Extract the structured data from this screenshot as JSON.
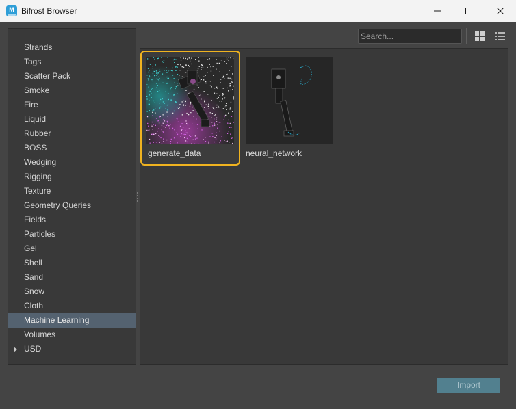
{
  "window": {
    "title": "Bifrost Browser",
    "app_icon_letter": "M",
    "controls": [
      "minimize-icon",
      "maximize-icon",
      "close-icon"
    ]
  },
  "sidebar": {
    "categories": [
      {
        "label": "Strands",
        "selected": false
      },
      {
        "label": "Tags",
        "selected": false
      },
      {
        "label": "Scatter Pack",
        "selected": false
      },
      {
        "label": "Smoke",
        "selected": false
      },
      {
        "label": "Fire",
        "selected": false
      },
      {
        "label": "Liquid",
        "selected": false
      },
      {
        "label": "Rubber",
        "selected": false
      },
      {
        "label": "BOSS",
        "selected": false
      },
      {
        "label": "Wedging",
        "selected": false
      },
      {
        "label": "Rigging",
        "selected": false
      },
      {
        "label": "Texture",
        "selected": false
      },
      {
        "label": "Geometry Queries",
        "selected": false
      },
      {
        "label": "Fields",
        "selected": false
      },
      {
        "label": "Particles",
        "selected": false
      },
      {
        "label": "Gel",
        "selected": false
      },
      {
        "label": "Shell",
        "selected": false
      },
      {
        "label": "Sand",
        "selected": false
      },
      {
        "label": "Snow",
        "selected": false
      },
      {
        "label": "Cloth",
        "selected": false
      },
      {
        "label": "Machine Learning",
        "selected": true
      },
      {
        "label": "Volumes",
        "selected": false
      },
      {
        "label": "USD",
        "selected": false,
        "expandable": true
      }
    ]
  },
  "toolbar": {
    "search_placeholder": "Search...",
    "search_value": "",
    "view_mode": "grid"
  },
  "content": {
    "items": [
      {
        "label": "generate_data",
        "selected": true,
        "thumbnail": "robot-arm-particles-thumbnail"
      },
      {
        "label": "neural_network",
        "selected": false,
        "thumbnail": "robot-arm-wireframe-thumbnail"
      }
    ]
  },
  "footer": {
    "import_label": "Import",
    "import_enabled": false
  },
  "colors": {
    "selection_border": "#f0b320",
    "selected_row": "#546270",
    "import_button": "#52808f"
  }
}
